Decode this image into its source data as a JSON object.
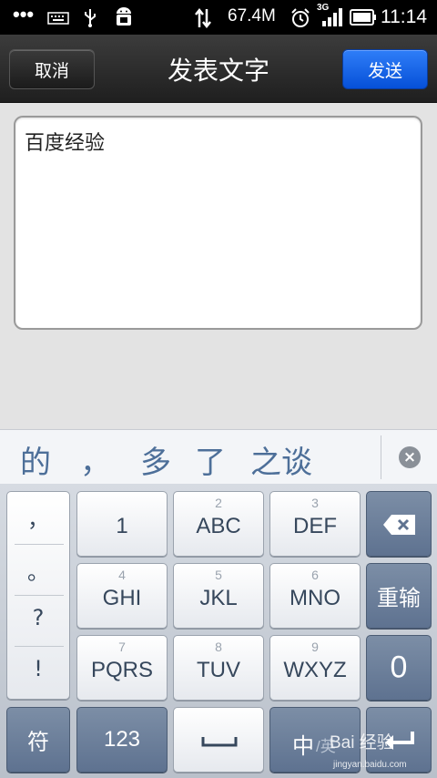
{
  "status_bar": {
    "dots": "•••",
    "speed": "67.4M",
    "network": "3G",
    "time": "11:14"
  },
  "title_bar": {
    "cancel_label": "取消",
    "title": "发表文字",
    "send_label": "发送"
  },
  "editor": {
    "text": "百度经验"
  },
  "candidates": {
    "items": [
      "的",
      "，",
      "多",
      "了",
      "之谈"
    ]
  },
  "keyboard": {
    "punctuation": [
      "，",
      "。",
      "?",
      "!"
    ],
    "keys": [
      {
        "num": "",
        "label": "1"
      },
      {
        "num": "2",
        "label": "ABC"
      },
      {
        "num": "3",
        "label": "DEF"
      },
      {
        "num": "4",
        "label": "GHI"
      },
      {
        "num": "5",
        "label": "JKL"
      },
      {
        "num": "6",
        "label": "MNO"
      },
      {
        "num": "7",
        "label": "PQRS"
      },
      {
        "num": "8",
        "label": "TUV"
      },
      {
        "num": "9",
        "label": "WXYZ"
      }
    ],
    "retype_label": "重输",
    "zero_label": "0",
    "symbol_label": "符",
    "numeric_label": "123",
    "space_label": "␣",
    "lang_zh": "中",
    "lang_en": "/英"
  },
  "watermark": {
    "text": "Bai 经验",
    "url": "jingyan.baidu.com"
  },
  "colors": {
    "send_button": "#1f6ef0",
    "candidate_text": "#4d6f99",
    "dark_key": "#6a7d98"
  }
}
